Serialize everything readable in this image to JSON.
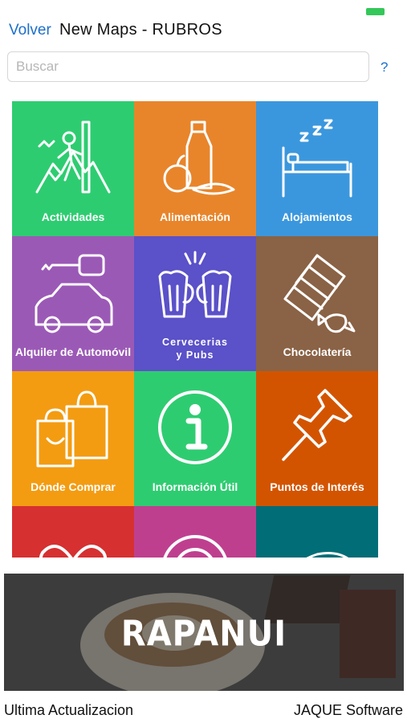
{
  "colors": {
    "accent": "#1d6fc9",
    "status_battery": "#34c759"
  },
  "nav": {
    "back_label": "Volver",
    "title": "New Maps - RUBROS"
  },
  "search": {
    "placeholder": "Buscar",
    "value": "",
    "help_label": "?"
  },
  "categories": [
    {
      "label": "Actividades",
      "color": "#2ecc71",
      "icon": "hiker-icon"
    },
    {
      "label": "Alimentación",
      "color": "#e8852b",
      "icon": "groceries-icon"
    },
    {
      "label": "Alojamientos",
      "color": "#3b97dd",
      "icon": "bed-icon"
    },
    {
      "label": "Alquiler de Automóvil",
      "color": "#9b59b6",
      "icon": "car-key-icon"
    },
    {
      "label": "Cervecerias\ny Pubs",
      "color": "#5b51c8",
      "icon": "beer-mugs-icon"
    },
    {
      "label": "Chocolatería",
      "color": "#8a6245",
      "icon": "chocolate-icon"
    },
    {
      "label": "Dónde Comprar",
      "color": "#f39c12",
      "icon": "shopping-bag-icon"
    },
    {
      "label": "Información Útil",
      "color": "#2ecc71",
      "icon": "info-icon"
    },
    {
      "label": "Puntos de Interés",
      "color": "#d35400",
      "icon": "pushpin-icon"
    },
    {
      "label": "",
      "color": "#d63031",
      "icon": "heart-icon"
    },
    {
      "label": "",
      "color": "#bf3f8f",
      "icon": "target-icon"
    },
    {
      "label": "",
      "color": "#006d77",
      "icon": "wave-icon"
    }
  ],
  "banner": {
    "brand": "RAPANUI"
  },
  "footer": {
    "left": "Ultima Actualizacion",
    "right": "JAQUE Software"
  }
}
